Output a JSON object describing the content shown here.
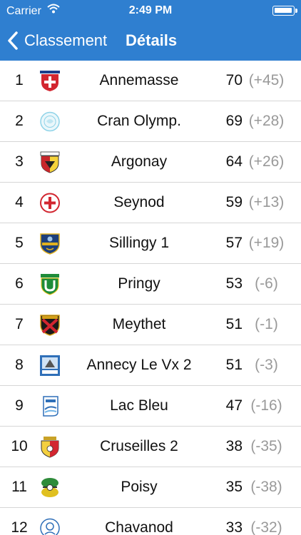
{
  "status_bar": {
    "carrier": "Carrier",
    "time": "2:49 PM"
  },
  "navbar": {
    "back_label": "Classement",
    "title": "Détails"
  },
  "rows": [
    {
      "rank": "1",
      "name": "Annemasse",
      "points": "70",
      "diff": "(+45)",
      "logo": "annemasse-crest-icon"
    },
    {
      "rank": "2",
      "name": "Cran Olymp.",
      "points": "69",
      "diff": "(+28)",
      "logo": "cran-olympique-crest-icon"
    },
    {
      "rank": "3",
      "name": "Argonay",
      "points": "64",
      "diff": "(+26)",
      "logo": "argonay-crest-icon"
    },
    {
      "rank": "4",
      "name": "Seynod",
      "points": "59",
      "diff": "(+13)",
      "logo": "seynod-crest-icon"
    },
    {
      "rank": "5",
      "name": "Sillingy 1",
      "points": "57",
      "diff": "(+19)",
      "logo": "sillingy-crest-icon"
    },
    {
      "rank": "6",
      "name": "Pringy",
      "points": "53",
      "diff": "(-6)",
      "logo": "pringy-crest-icon"
    },
    {
      "rank": "7",
      "name": "Meythet",
      "points": "51",
      "diff": "(-1)",
      "logo": "meythet-crest-icon"
    },
    {
      "rank": "8",
      "name": "Annecy Le Vx 2",
      "points": "51",
      "diff": "(-3)",
      "logo": "annecy-le-vieux-crest-icon"
    },
    {
      "rank": "9",
      "name": "Lac Bleu",
      "points": "47",
      "diff": "(-16)",
      "logo": "lac-bleu-crest-icon"
    },
    {
      "rank": "10",
      "name": "Cruseilles 2",
      "points": "38",
      "diff": "(-35)",
      "logo": "cruseilles-crest-icon"
    },
    {
      "rank": "11",
      "name": "Poisy",
      "points": "35",
      "diff": "(-38)",
      "logo": "poisy-crest-icon"
    },
    {
      "rank": "12",
      "name": "Chavanod",
      "points": "33",
      "diff": "(-32)",
      "logo": "chavanod-crest-icon"
    }
  ],
  "colors": {
    "header": "#2f7fd0",
    "divider": "#d6d6d6",
    "diff_text": "#999999"
  }
}
